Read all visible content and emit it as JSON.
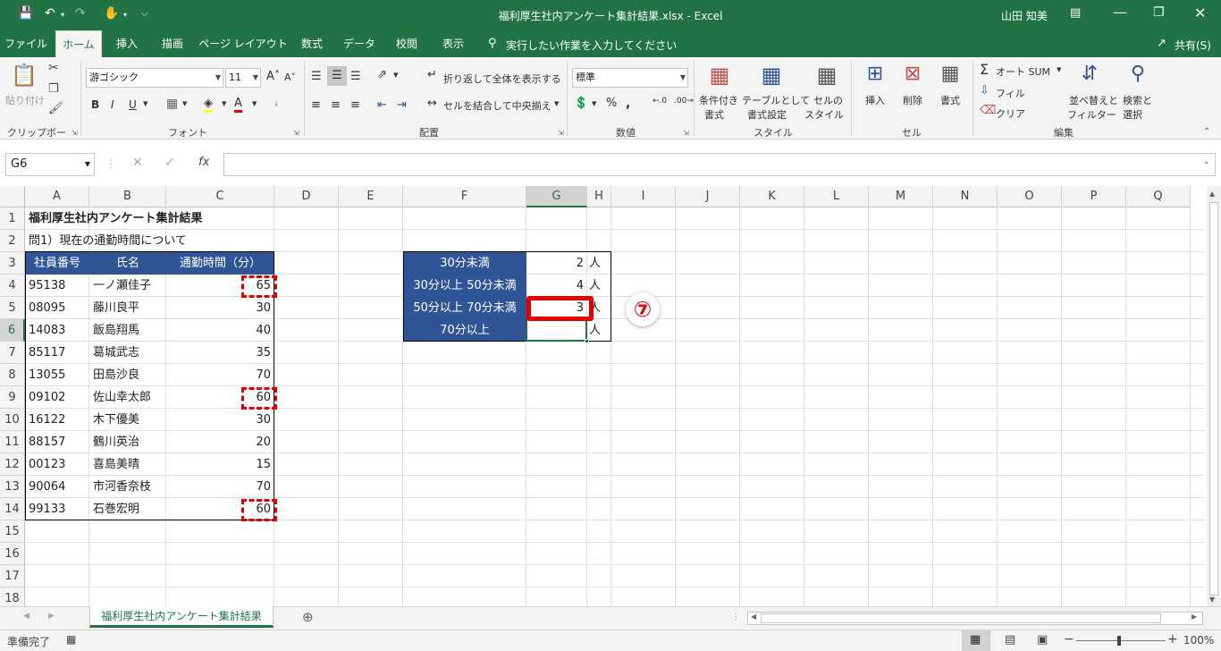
{
  "window": {
    "title": "福利厚生社内アンケート集計結果.xlsx  -  Excel",
    "user": "山田 知美"
  },
  "tabs": [
    "ファイル",
    "ホーム",
    "挿入",
    "描画",
    "ページ レイアウト",
    "数式",
    "データ",
    "校閲",
    "表示"
  ],
  "tell_me": "実行したい作業を入力してください",
  "share": "共有(S)",
  "ribbon": {
    "clipboard": {
      "paste": "貼り付け",
      "label": "クリップボード"
    },
    "font": {
      "name": "游ゴシック",
      "size": "11",
      "label": "フォント"
    },
    "alignment": {
      "wrap": "折り返して全体を表示する",
      "merge": "セルを結合して中央揃え",
      "label": "配置"
    },
    "number": {
      "format": "標準",
      "label": "数値"
    },
    "styles": {
      "cond1": "条件付き",
      "cond2": "書式",
      "table1": "テーブルとして",
      "table2": "書式設定",
      "cell1": "セルの",
      "cell2": "スタイル",
      "label": "スタイル"
    },
    "cells": {
      "insert": "挿入",
      "delete": "削除",
      "format": "書式",
      "label": "セル"
    },
    "editing": {
      "autosum": "オート SUM",
      "fill": "フィル",
      "clear": "クリア",
      "sort1": "並べ替えと",
      "sort2": "フィルター",
      "find1": "検索と",
      "find2": "選択",
      "label": "編集"
    }
  },
  "formula_bar": {
    "name_box": "G6",
    "fx": "fx",
    "value": ""
  },
  "columns": [
    "A",
    "B",
    "C",
    "D",
    "E",
    "F",
    "G",
    "H",
    "I",
    "J",
    "K",
    "L",
    "M",
    "N",
    "O",
    "P",
    "Q"
  ],
  "rows": [
    "1",
    "2",
    "3",
    "4",
    "5",
    "6",
    "7",
    "8",
    "9",
    "10",
    "11",
    "12",
    "13",
    "14",
    "15",
    "16",
    "17",
    "18"
  ],
  "sheet": {
    "title": "福利厚生社内アンケート集計結果",
    "question": "問1）現在の通勤時間について",
    "headers": [
      "社員番号",
      "氏名",
      "通勤時間（分）"
    ],
    "records": [
      [
        "95138",
        "一ノ瀬佳子",
        "65"
      ],
      [
        "08095",
        "藤川良平",
        "30"
      ],
      [
        "14083",
        "飯島翔馬",
        "40"
      ],
      [
        "85117",
        "葛城武志",
        "35"
      ],
      [
        "13055",
        "田島沙良",
        "70"
      ],
      [
        "09102",
        "佐山幸太郎",
        "60"
      ],
      [
        "16122",
        "木下優美",
        "30"
      ],
      [
        "88157",
        "鶴川英治",
        "20"
      ],
      [
        "00123",
        "喜島美晴",
        "15"
      ],
      [
        "90064",
        "市河香奈枝",
        "70"
      ],
      [
        "99133",
        "石巻宏明",
        "60"
      ]
    ],
    "summary": [
      [
        "30分未満",
        "2",
        "人"
      ],
      [
        "30分以上 50分未満",
        "4",
        "人"
      ],
      [
        "50分以上 70分未満",
        "3",
        "人"
      ],
      [
        "70分以上",
        "",
        "人"
      ]
    ]
  },
  "callout": "⑦",
  "sheet_tab": "福利厚生社内アンケート集計結果",
  "status": {
    "ready": "準備完了",
    "zoom": "100%"
  },
  "colors": {
    "excel_green": "#217346",
    "header_blue": "#2f5597",
    "highlight_red": "#e00000"
  }
}
